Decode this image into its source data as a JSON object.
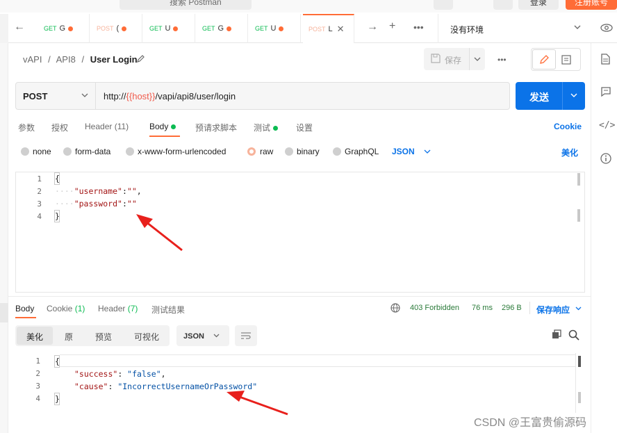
{
  "topbar": {
    "search_placeholder": "搜索 Postman",
    "sign_in": "登录",
    "register": "注册账号"
  },
  "tabs": [
    {
      "method": "GET",
      "name": "G",
      "color": "#0cbb52"
    },
    {
      "method": "POST",
      "name": "(",
      "color": "#f7b39b"
    },
    {
      "method": "GET",
      "name": "U",
      "color": "#0cbb52"
    },
    {
      "method": "GET",
      "name": "G",
      "color": "#0cbb52"
    },
    {
      "method": "GET",
      "name": "U",
      "color": "#0cbb52"
    },
    {
      "method": "POST",
      "name": "L",
      "color": "#f7b39b",
      "active": true
    }
  ],
  "environment": "没有环境",
  "breadcrumb": {
    "part1": "vAPI",
    "sep": "/",
    "part2": "API8",
    "current": "User Login"
  },
  "save_label": "保存",
  "request": {
    "method": "POST",
    "url_prefix": "http://",
    "url_var": "{{host}}",
    "url_suffix": "/vapi/api8/user/login",
    "send_label": "发送"
  },
  "request_tabs": {
    "params": "参数",
    "auth": "授权",
    "headers": "Header (11)",
    "body": "Body",
    "prerequest": "预请求脚本",
    "tests": "测试",
    "settings": "设置",
    "cookies": "Cookie"
  },
  "body_types": {
    "none": "none",
    "form_data": "form-data",
    "urlencoded": "x-www-form-urlencoded",
    "raw": "raw",
    "binary": "binary",
    "graphql": "GraphQL",
    "lang": "JSON",
    "beautify": "美化"
  },
  "request_body": {
    "line_numbers": [
      "1",
      "2",
      "3",
      "4"
    ],
    "open": "{",
    "indent": "····",
    "key1": "\"username\"",
    "colon1": ":",
    "val1": "\"\"",
    "comma": ",",
    "key2": "\"password\"",
    "colon2": ":",
    "val2": "\"\"",
    "close": "}"
  },
  "response_tabs": {
    "body": "Body",
    "cookie": "Cookie",
    "cookie_count": "(1)",
    "header": "Header",
    "header_count": "(7)",
    "tests": "测试结果"
  },
  "response_status": {
    "status": "403 Forbidden",
    "time": "76 ms",
    "size": "296 B",
    "save": "保存响应"
  },
  "response_format": {
    "pretty": "美化",
    "raw": "原",
    "preview": "预览",
    "visualize": "可视化",
    "lang": "JSON"
  },
  "response_body": {
    "line_numbers": [
      "1",
      "2",
      "3",
      "4"
    ],
    "open": "{",
    "key1": "\"success\"",
    "val1": "\"false\"",
    "key2": "\"cause\"",
    "val2": "\"IncorrectUsernameOrPassword\"",
    "colon": ": ",
    "comma": ",",
    "close": "}"
  },
  "watermark": "CSDN @王富贵偷源码",
  "colors": {
    "accent": "#ff6c37",
    "send": "#0b73e8",
    "success_green": "#0cbb52",
    "arrow": "#e8201c"
  }
}
